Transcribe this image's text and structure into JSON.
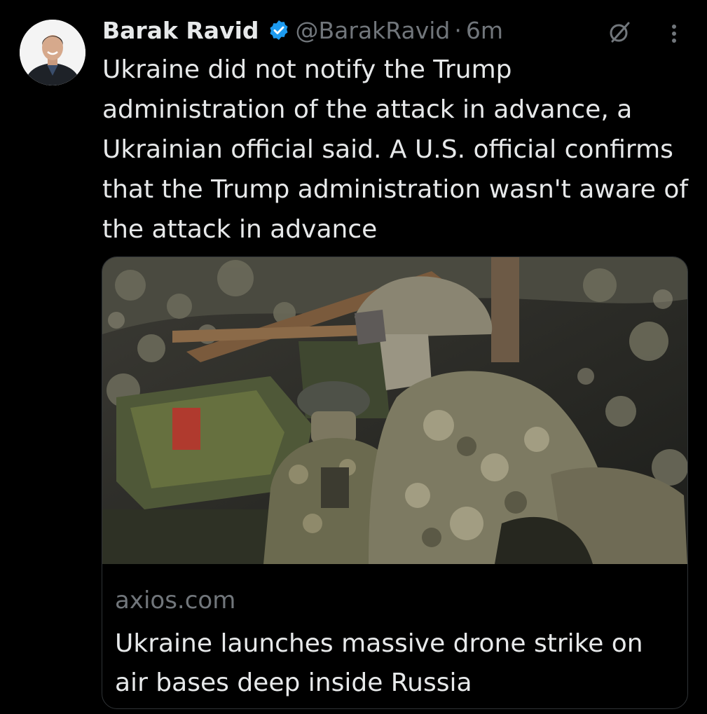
{
  "author": {
    "display_name": "Barak Ravid",
    "handle": "@BarakRavid",
    "separator": "·",
    "time": "6m",
    "verified_color": "#1d9bf0"
  },
  "tweet": {
    "text": "Ukraine did not notify the Trump administration of the attack in advance, a Ukrainian official said. A U.S. official confirms that the Trump administration wasn't aware of the attack in advance"
  },
  "card": {
    "domain": "axios.com",
    "title": "Ukraine launches massive drone strike on air bases deep inside Russia"
  },
  "icons": {
    "avatar": "avatar",
    "verified": "verified-badge-icon",
    "grok": "grok-icon",
    "more": "more-options-icon"
  },
  "colors": {
    "background": "#000000",
    "text": "#e7e9ea",
    "muted": "#71767b",
    "border": "#2f3336"
  }
}
